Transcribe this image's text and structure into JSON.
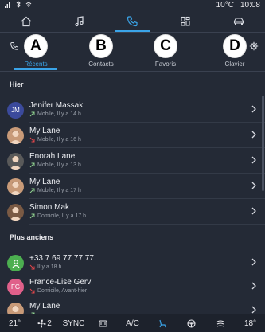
{
  "status_bar": {
    "time": "10:08",
    "temperature": "10°C"
  },
  "top_nav": {
    "items": [
      "home-icon",
      "music-icon",
      "phone-icon",
      "apps-icon",
      "car-icon"
    ],
    "active": 2
  },
  "header": {
    "title": "hone"
  },
  "tabs": [
    {
      "letter": "A",
      "label": "Récents",
      "active": true
    },
    {
      "letter": "B",
      "label": "Contacts",
      "active": false
    },
    {
      "letter": "C",
      "label": "Favoris",
      "active": false
    },
    {
      "letter": "D",
      "label": "Clavier",
      "active": false
    }
  ],
  "sections": {
    "yesterday": "Hier",
    "older": "Plus anciens"
  },
  "calls_yesterday": [
    {
      "name": "Jenifer Massak",
      "detail": "Mobile, Il y a 14 h",
      "avatar_text": "JM",
      "avatar_color": "#3b4a9c",
      "call": "outgoing"
    },
    {
      "name": "My Lane",
      "detail": "Mobile, Il y a 16 h",
      "avatar_text": "",
      "avatar_color": "#c89a78",
      "call": "missed"
    },
    {
      "name": "Enorah Lane",
      "detail": "Mobile, Il y a 13 h",
      "avatar_text": "",
      "avatar_color": "#5a5a5a",
      "call": "outgoing"
    },
    {
      "name": "My Lane",
      "detail": "Mobile, Il y a 17 h",
      "avatar_text": "",
      "avatar_color": "#c89a78",
      "call": "outgoing"
    },
    {
      "name": "Simon Mak",
      "detail": "Domicile, Il y a 17 h",
      "avatar_text": "",
      "avatar_color": "#7a5a44",
      "call": "outgoing"
    }
  ],
  "calls_older": [
    {
      "name": "+33 7 69 77 77 77",
      "detail": "Il y a 18 h",
      "avatar_text": "",
      "avatar_color": "#4caf50",
      "call": "missed"
    },
    {
      "name": "France-Lise Gerv",
      "detail": "Domicile, Avant-hier",
      "avatar_text": "FG",
      "avatar_color": "#e0608a",
      "call": "missed"
    },
    {
      "name": "My Lane",
      "detail": "",
      "avatar_text": "",
      "avatar_color": "#c89a78",
      "call": "outgoing"
    }
  ],
  "bottom_bar": {
    "temp_left": "21°",
    "fan_level": "2",
    "sync": "SYNC",
    "ac": "A/C",
    "temp_right": "18°"
  },
  "colors": {
    "accent": "#3aa4e8",
    "background": "#242a36",
    "missed": "#e0454a"
  }
}
